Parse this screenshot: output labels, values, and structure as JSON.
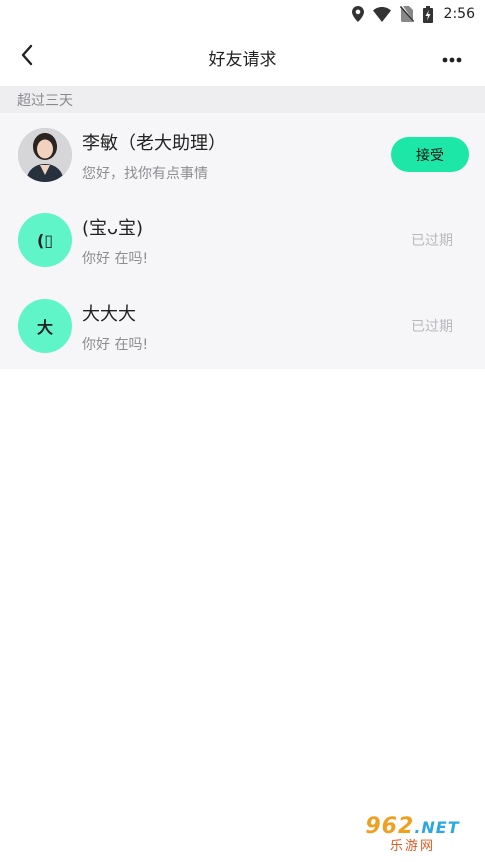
{
  "status_bar": {
    "time": "2:56",
    "icons": [
      "location-icon",
      "wifi-icon",
      "no-sim-icon",
      "battery-charging-icon"
    ]
  },
  "header": {
    "title": "好友请求",
    "back_icon": "chevron-left-icon",
    "more_icon": "more-horizontal-icon"
  },
  "section": {
    "title": "超过三天"
  },
  "requests": [
    {
      "name": "李敏（老大助理）",
      "message": "您好，找你有点事情",
      "avatar_type": "photo",
      "action": "接受"
    },
    {
      "name": "(宝ᴗ宝)",
      "message": "你好 在吗!",
      "avatar_text": "(▯",
      "avatar_color": "#5ff5c9",
      "status": "已过期"
    },
    {
      "name": "大大大",
      "message": "你好  在吗!",
      "avatar_text": "大",
      "avatar_color": "#5ff5c9",
      "status": "已过期"
    }
  ],
  "colors": {
    "accent": "#1de7a7",
    "avatar_mint": "#5ff5c9",
    "section_bg": "#eeeef1",
    "list_bg": "#f6f6f8"
  },
  "watermark": {
    "brand": "962",
    "suffix": ".NET",
    "caption": "乐游网"
  }
}
